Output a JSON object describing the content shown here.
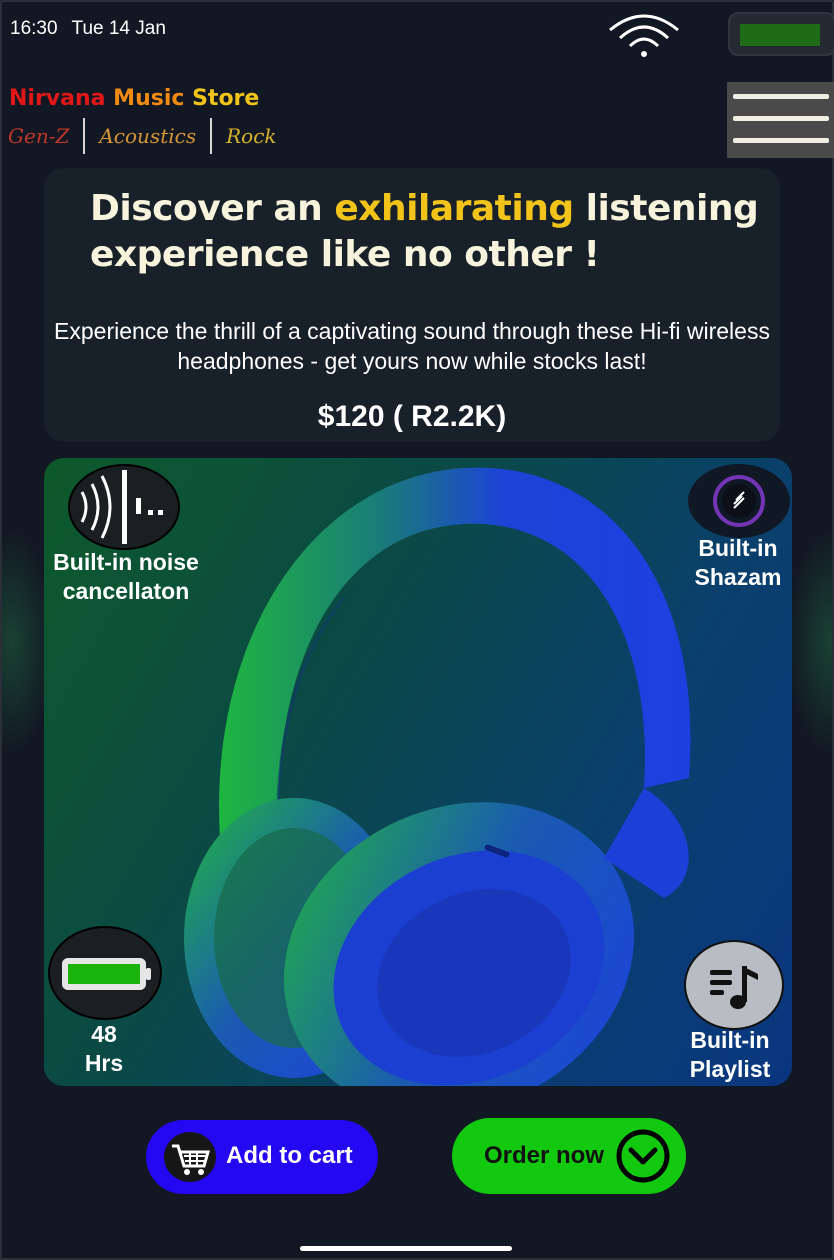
{
  "status_bar": {
    "time": "16:30",
    "date": "Tue 14 Jan",
    "wifi_icon": "wifi-icon",
    "battery_icon": "battery-icon"
  },
  "brand": {
    "word1": "Nirvana",
    "word2": "Music",
    "word3": "Store",
    "genres": [
      "Gen-Z",
      "Acoustics",
      "Rock"
    ]
  },
  "menu": {
    "icon": "hamburger-menu-icon"
  },
  "hero": {
    "headline_before": "Discover an ",
    "headline_highlight": "exhilarating",
    "headline_after": " listening experience like no other !",
    "subline": "Experience the thrill of a captivating sound through these Hi-fi wireless headphones - get yours now while stocks last!",
    "price": "$120 ( R2.2K)"
  },
  "features": {
    "noise": {
      "label_line1": "Built-in noise",
      "label_line2": "cancellaton",
      "icon": "noise-cancellation-icon"
    },
    "shazam": {
      "label_line1": "Built-in",
      "label_line2": "Shazam",
      "icon": "shazam-icon"
    },
    "battery": {
      "label_line1": "48",
      "label_line2": "Hrs",
      "icon": "battery-life-icon"
    },
    "playlist": {
      "label_line1": "Built-in",
      "label_line2": "Playlist",
      "icon": "playlist-icon"
    }
  },
  "actions": {
    "add_to_cart": "Add to cart",
    "order_now": "Order now",
    "cart_icon": "shopping-cart-icon",
    "order_icon": "chevron-down-circle-icon"
  },
  "colors": {
    "background": "#121823",
    "brand_red": "#e11717",
    "brand_orange": "#f08a12",
    "brand_yellow": "#f2c41a",
    "cart_button": "#2508f2",
    "order_button": "#12c910"
  }
}
